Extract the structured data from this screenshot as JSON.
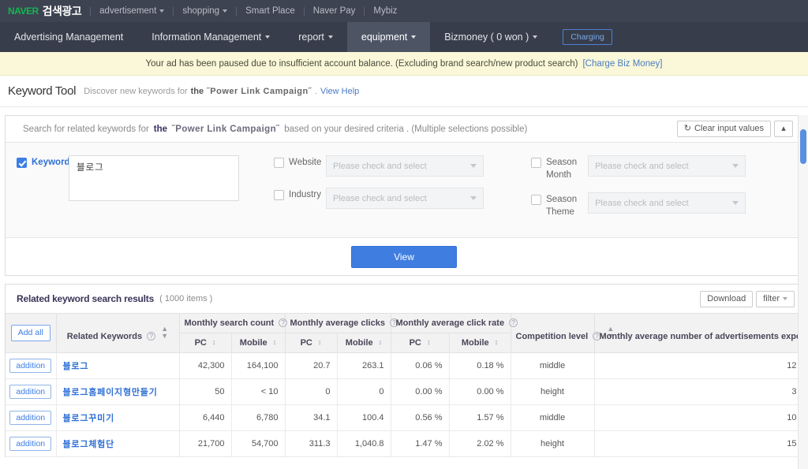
{
  "gnb": {
    "logo": "NAVER",
    "title": "검색광고",
    "links": [
      {
        "label": "advertisement",
        "caret": true
      },
      {
        "label": "shopping",
        "caret": true
      },
      {
        "label": "Smart Place",
        "caret": false
      },
      {
        "label": "Naver Pay",
        "caret": false
      },
      {
        "label": "Mybiz",
        "caret": false
      }
    ]
  },
  "lnb": {
    "items": [
      {
        "label": "Advertising Management",
        "caret": false,
        "active": false
      },
      {
        "label": "Information Management",
        "caret": true,
        "active": false
      },
      {
        "label": "report",
        "caret": true,
        "active": false
      },
      {
        "label": "equipment",
        "caret": true,
        "active": true
      },
      {
        "label": "Bizmoney ( 0 won )",
        "caret": true,
        "active": false
      }
    ],
    "charge_button": "Charging"
  },
  "notice": {
    "text": "Your ad has been paused due to insufficient account balance. (Excluding brand search/new product search)",
    "link": "[Charge Biz Money]"
  },
  "page": {
    "title": "Keyword Tool",
    "desc_prefix": "Discover new keywords for",
    "desc_bold": "the",
    "campaign": "˝Power Link Campaign˝",
    "desc_suffix": ".",
    "help_link": "View Help"
  },
  "search_panel": {
    "head_prefix": "Search for related keywords for",
    "head_bold": "the",
    "campaign": "˝Power Link Campaign˝",
    "head_suffix": "based on your desired criteria . (Multiple selections possible)",
    "clear_button": "Clear input values",
    "collapse_icon": "chevron-up-icon",
    "fields": {
      "keyword": {
        "label": "Keyword",
        "checked": true,
        "value": "블로그"
      },
      "website": {
        "label": "Website",
        "checked": false,
        "placeholder": "Please check and select"
      },
      "industry": {
        "label": "Industry",
        "checked": false,
        "placeholder": "Please check and select"
      },
      "season_month": {
        "label": "Season Month",
        "checked": false,
        "placeholder": "Please check and select"
      },
      "season_theme": {
        "label": "Season Theme",
        "checked": false,
        "placeholder": "Please check and select"
      }
    },
    "view_button": "View"
  },
  "results": {
    "title": "Related keyword search results",
    "count": "( 1000 items )",
    "download_button": "Download",
    "filter_button": "filter",
    "add_all_button": "Add all",
    "columns": {
      "related_keywords": "Related Keywords",
      "monthly_search_count": "Monthly search count",
      "monthly_average_clicks": "Monthly average clicks",
      "monthly_average_click_rate": "Monthly average click rate",
      "competition_level": "Competition level",
      "monthly_ads_exposed": "Monthly average number of advertisements exposed",
      "pc": "PC",
      "mobile": "Mobile"
    },
    "add_label": "addition",
    "rows": [
      {
        "keyword": "블로그",
        "search_pc": "42,300",
        "search_mobile": "164,100",
        "clicks_pc": "20.7",
        "clicks_mobile": "263.1",
        "ctr_pc": "0.06 %",
        "ctr_mobile": "0.18 %",
        "competition": "middle",
        "ads": "12"
      },
      {
        "keyword": "블로그홈페이지형만들기",
        "search_pc": "50",
        "search_mobile": "< 10",
        "clicks_pc": "0",
        "clicks_mobile": "0",
        "ctr_pc": "0.00 %",
        "ctr_mobile": "0.00 %",
        "competition": "height",
        "ads": "3"
      },
      {
        "keyword": "블로그꾸미기",
        "search_pc": "6,440",
        "search_mobile": "6,780",
        "clicks_pc": "34.1",
        "clicks_mobile": "100.4",
        "ctr_pc": "0.56 %",
        "ctr_mobile": "1.57 %",
        "competition": "middle",
        "ads": "10"
      },
      {
        "keyword": "블로그체험단",
        "search_pc": "21,700",
        "search_mobile": "54,700",
        "clicks_pc": "311.3",
        "clicks_mobile": "1,040.8",
        "ctr_pc": "1.47 %",
        "ctr_mobile": "2.02 %",
        "competition": "height",
        "ads": "15"
      }
    ]
  },
  "colors": {
    "brand_green": "#15b551",
    "gnb_bg": "#3d4351",
    "lnb_bg": "#373d4a",
    "accent_blue": "#3d7ee6",
    "notice_bg": "#faf8d8"
  }
}
